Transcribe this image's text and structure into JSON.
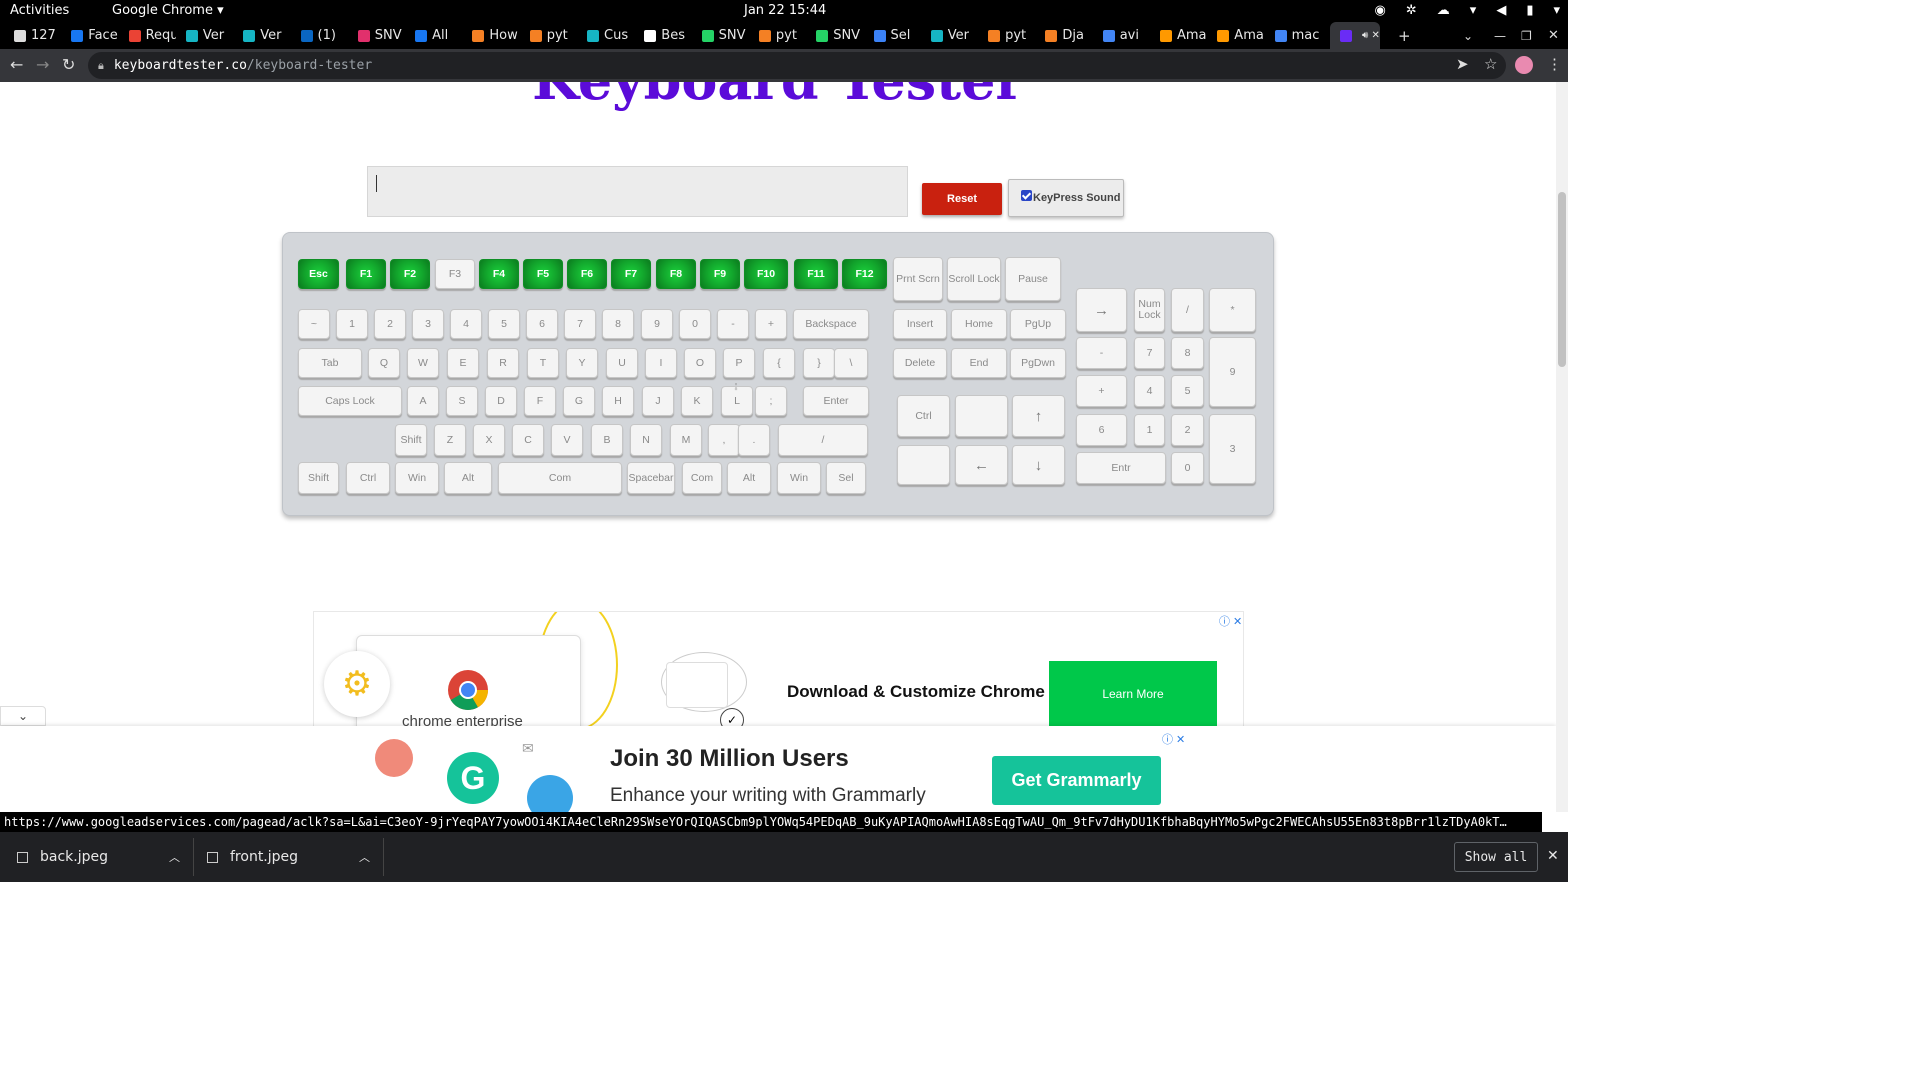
{
  "topbar": {
    "activities": "Activities",
    "app_name": "Google Chrome ▾",
    "clock": "Jan 22  15:44"
  },
  "tabs": [
    {
      "label": "127",
      "color": "#dddddd"
    },
    {
      "label": "Face",
      "color": "#1877f2"
    },
    {
      "label": "Requ",
      "color": "#ea4335"
    },
    {
      "label": "Ver",
      "color": "#16b5c4"
    },
    {
      "label": "Ver",
      "color": "#16b5c4"
    },
    {
      "label": "(1)",
      "color": "#0a66c2"
    },
    {
      "label": "SNV",
      "color": "#e1306c"
    },
    {
      "label": "All",
      "color": "#1877f2"
    },
    {
      "label": "How",
      "color": "#f48024"
    },
    {
      "label": "pyt",
      "color": "#f48024"
    },
    {
      "label": "Cus",
      "color": "#16b5c4"
    },
    {
      "label": "Bes",
      "color": "#ffffff"
    },
    {
      "label": "SNV",
      "color": "#25d366"
    },
    {
      "label": "pyt",
      "color": "#f48024"
    },
    {
      "label": "SNV",
      "color": "#25d366"
    },
    {
      "label": "Sel",
      "color": "#3b82f6"
    },
    {
      "label": "Ver",
      "color": "#16b5c4"
    },
    {
      "label": "pyt",
      "color": "#f48024"
    },
    {
      "label": "Dja",
      "color": "#f48024"
    },
    {
      "label": "avi",
      "color": "#4285f4"
    },
    {
      "label": "Ama",
      "color": "#ff9900"
    },
    {
      "label": "Ama",
      "color": "#ff9900"
    },
    {
      "label": "mac",
      "color": "#4285f4"
    },
    {
      "label": "",
      "color": "#6a2cf5"
    }
  ],
  "address": {
    "host": "keyboardtester.co",
    "path": "/keyboard-tester"
  },
  "page": {
    "title": "Keyboard Tester",
    "reset_label": "Reset",
    "sound_label": "KeyPress Sound",
    "sound_checked": true
  },
  "keyboard": {
    "pressed_color": "#12a52c",
    "keys": [
      {
        "label": "Esc",
        "pressed": true
      },
      {
        "label": "F1",
        "pressed": true
      },
      {
        "label": "F2",
        "pressed": true
      },
      {
        "label": "F3",
        "pressed": false
      },
      {
        "label": "F4",
        "pressed": true
      },
      {
        "label": "F5",
        "pressed": true
      },
      {
        "label": "F6",
        "pressed": true
      },
      {
        "label": "F7",
        "pressed": true
      },
      {
        "label": "F8",
        "pressed": true
      },
      {
        "label": "F9",
        "pressed": true
      },
      {
        "label": "F10",
        "pressed": true
      },
      {
        "label": "F11",
        "pressed": true
      },
      {
        "label": "F12",
        "pressed": true
      },
      {
        "label": "Prnt Scrn"
      },
      {
        "label": "Scroll Lock"
      },
      {
        "label": "Pause"
      },
      {
        "label": "~"
      },
      {
        "label": "1"
      },
      {
        "label": "2"
      },
      {
        "label": "3"
      },
      {
        "label": "4"
      },
      {
        "label": "5"
      },
      {
        "label": "6"
      },
      {
        "label": "7"
      },
      {
        "label": "8"
      },
      {
        "label": "9"
      },
      {
        "label": "0"
      },
      {
        "label": "-"
      },
      {
        "label": "+"
      },
      {
        "label": "Backspace"
      },
      {
        "label": "Insert"
      },
      {
        "label": "Home"
      },
      {
        "label": "PgUp"
      },
      {
        "label": "Tab"
      },
      {
        "label": "Q"
      },
      {
        "label": "W"
      },
      {
        "label": "E"
      },
      {
        "label": "R"
      },
      {
        "label": "T"
      },
      {
        "label": "Y"
      },
      {
        "label": "U"
      },
      {
        "label": "I"
      },
      {
        "label": "O"
      },
      {
        "label": "P"
      },
      {
        "label": "{"
      },
      {
        "label": "}"
      },
      {
        "label": "\\"
      },
      {
        "label": "Delete"
      },
      {
        "label": "End"
      },
      {
        "label": "PgDwn"
      },
      {
        "label": "Caps Lock"
      },
      {
        "label": "A"
      },
      {
        "label": "S"
      },
      {
        "label": "D"
      },
      {
        "label": "F"
      },
      {
        "label": "G"
      },
      {
        "label": "H"
      },
      {
        "label": "J"
      },
      {
        "label": "K"
      },
      {
        "label": "L"
      },
      {
        "label": ";"
      },
      {
        "label": "'"
      },
      {
        "label": "Enter"
      },
      {
        "label": "Shift"
      },
      {
        "label": "Z"
      },
      {
        "label": "X"
      },
      {
        "label": "C"
      },
      {
        "label": "V"
      },
      {
        "label": "B"
      },
      {
        "label": "N"
      },
      {
        "label": "M"
      },
      {
        "label": ","
      },
      {
        "label": "."
      },
      {
        "label": "/"
      },
      {
        "label": "Shift"
      },
      {
        "label": "Ctrl"
      },
      {
        "label": "Win"
      },
      {
        "label": "Alt"
      },
      {
        "label": "Com"
      },
      {
        "label": "Spacebar"
      },
      {
        "label": "Com"
      },
      {
        "label": "Alt"
      },
      {
        "label": "Win"
      },
      {
        "label": "Sel"
      },
      {
        "label": "Ctrl"
      },
      {
        "label": ""
      },
      {
        "label": "↑"
      },
      {
        "label": ""
      },
      {
        "label": "←"
      },
      {
        "label": "↓"
      },
      {
        "label": "→"
      },
      {
        "label": "Num Lock"
      },
      {
        "label": "/"
      },
      {
        "label": "*"
      },
      {
        "label": "-"
      },
      {
        "label": "7"
      },
      {
        "label": "8"
      },
      {
        "label": "9"
      },
      {
        "label": "+"
      },
      {
        "label": "4"
      },
      {
        "label": "5"
      },
      {
        "label": "6"
      },
      {
        "label": "1"
      },
      {
        "label": "2"
      },
      {
        "label": "3"
      },
      {
        "label": "Entr"
      },
      {
        "label": "0"
      },
      {
        "label": "."
      }
    ]
  },
  "ad1": {
    "product_caption": "chrome enterprise",
    "headline": "Download & Customize Chrome",
    "cta": "Learn More"
  },
  "ad2": {
    "headline": "Join 30 Million Users",
    "subtitle": "Enhance your writing with Grammarly",
    "cta": "Get Grammarly",
    "logo_letter": "G"
  },
  "status_url": "https://www.googleadservices.com/pagead/aclk?sa=L&ai=C3eoY-9jrYeqPAY7yowOOi4KIA4eCleRn29SWseYOrQIQASCbm9plYOWq54PEDqAB_9uKyAPIAQmoAwHIA8sEqgTwAU_Qm_9tFv7dHyDU1KfbhaBqyHYMo5wPgc2FWECAhsU55En83t8pBrr1lzTDyA0kT…",
  "downloads": [
    {
      "name": "back.jpeg"
    },
    {
      "name": "front.jpeg"
    }
  ],
  "shelf": {
    "show_all": "Show all"
  }
}
